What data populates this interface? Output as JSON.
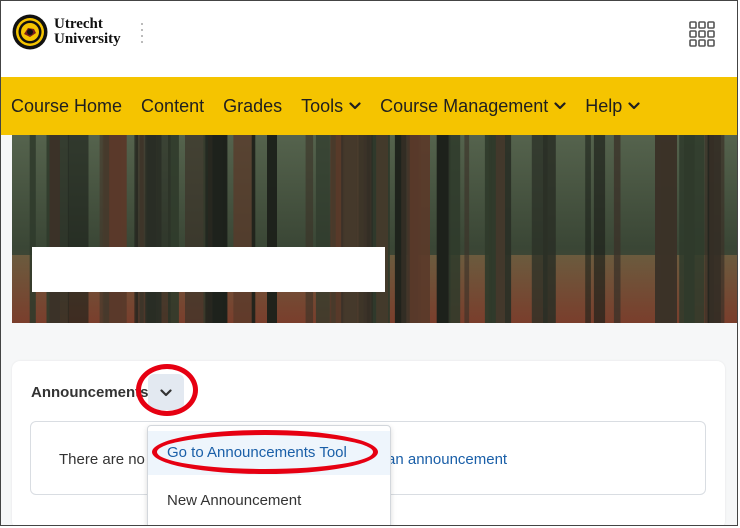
{
  "header": {
    "logo_line1": "Utrecht",
    "logo_line2": "University",
    "logo_icon": "university-seal-icon",
    "apps_icon": "grid-apps-icon"
  },
  "nav": {
    "items": [
      {
        "label": "Course Home",
        "dropdown": false
      },
      {
        "label": "Content",
        "dropdown": false
      },
      {
        "label": "Grades",
        "dropdown": false
      },
      {
        "label": "Tools",
        "dropdown": true
      },
      {
        "label": "Course Management",
        "dropdown": true
      },
      {
        "label": "Help",
        "dropdown": true
      }
    ],
    "background": "#f5c400"
  },
  "widget": {
    "title": "Announcements",
    "message_prefix": "There are no",
    "message_link": "an announcement",
    "toggle_icon": "chevron-down-icon"
  },
  "dropdown_menu": {
    "items": [
      {
        "label": "Go to Announcements Tool",
        "highlighted": true
      },
      {
        "label": "New Announcement",
        "highlighted": false
      }
    ]
  },
  "annotations": {
    "highlight_color": "#e60012"
  }
}
